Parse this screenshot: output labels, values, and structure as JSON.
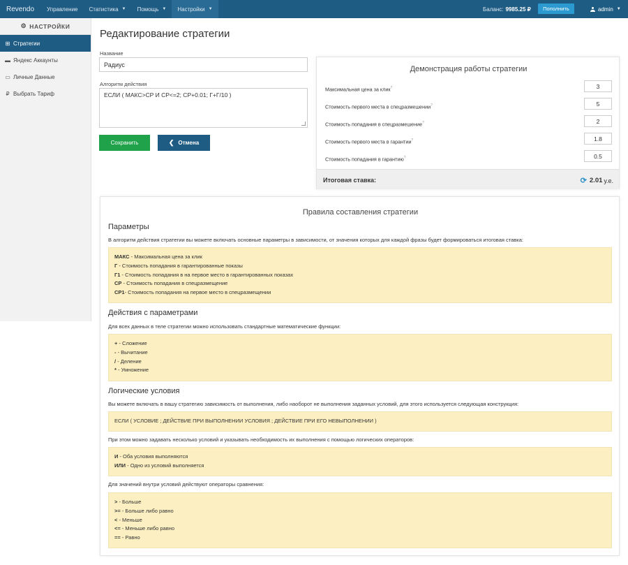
{
  "topbar": {
    "brand": "Revendo",
    "nav": [
      {
        "label": "Управление",
        "dropdown": false
      },
      {
        "label": "Статистика",
        "dropdown": true
      },
      {
        "label": "Помощь",
        "dropdown": true
      },
      {
        "label": "Настройки",
        "dropdown": true,
        "active": true
      }
    ],
    "balance_label": "Баланс:",
    "balance_value": "9985.25 ₽",
    "topup_button": "Пополнить",
    "user": "admin"
  },
  "sidebar": {
    "heading": "НАСТРОЙКИ",
    "items": [
      {
        "label": "Стратегии",
        "icon": "sitemap-icon",
        "active": true
      },
      {
        "label": "Яндекс Аккаунты",
        "icon": "car-icon",
        "active": false
      },
      {
        "label": "Личные Данные",
        "icon": "id-card-icon",
        "active": false
      },
      {
        "label": "Выбрать Тариф",
        "icon": "ruble-icon",
        "active": false
      }
    ]
  },
  "main": {
    "title": "Редактирование стратегии",
    "name_label": "Название",
    "name_value": "Радиус",
    "algo_label": "Алгоритм действия",
    "algo_value": "ЕСЛИ ( МАКС>СР И СР<=2; СР+0.01; Г+Г/10 )",
    "save_button": "Сохранить",
    "cancel_button": "Отмена"
  },
  "demo": {
    "title": "Демонстрация работы стратегии",
    "rows": [
      {
        "label": "Максимальная цена за клик",
        "value": "3"
      },
      {
        "label": "Стоимость первого места в спецразмешении",
        "value": "5"
      },
      {
        "label": "Стоимость попадания в спецразмешение",
        "value": "2"
      },
      {
        "label": "Стоимость первого места в гарантии",
        "value": "1.8"
      },
      {
        "label": "Стоимость попадания в гарантию",
        "value": "0.5"
      }
    ],
    "total_label": "Итоговая ставка:",
    "total_value": "2.01",
    "total_unit": "у.е."
  },
  "rules": {
    "title": "Правила составления стратегии",
    "params_heading": "Параметры",
    "params_intro": "В алгоритм действия стратегии вы можете включать основные параметры в зависимости, от значения которых для каждой фразы будет формироваться итоговая ставка:",
    "params": [
      {
        "key": "МАКС",
        "desc": " - Максимальная цена за клик"
      },
      {
        "key": "Г",
        "desc": " - Стоимость попадания в гарантированные показы"
      },
      {
        "key": "Г1",
        "desc": " - Стоимость попадания в на первое место в гарантированных показах"
      },
      {
        "key": "СР",
        "desc": " - Стоимость попадания в спецразмещение"
      },
      {
        "key": "СР1",
        "desc": "- Стоимость попадания на первое место в спецразмещении"
      }
    ],
    "actions_heading": "Действия с параметрами",
    "actions_intro": "Для всех данных в теле стратегии можно использовать стандартные математические функции:",
    "actions": [
      {
        "key": "+",
        "desc": " - Сложение"
      },
      {
        "key": "-",
        "desc": " - Вычитание"
      },
      {
        "key": "/",
        "desc": " - Деление"
      },
      {
        "key": "*",
        "desc": " - Умножение"
      }
    ],
    "logic_heading": "Логические условия",
    "logic_intro": "Вы можете включать в вашу стратегию зависимость от выполнения, либо наоборот не выполнения заданных условий, для этого используется следующая конструкция:",
    "logic_construct": "ЕСЛИ ( УСЛОВИЕ ; ДЕЙСТВИЕ ПРИ ВЫПОЛНЕНИИ УСЛОВИЯ ; ДЕЙСТВИЕ ПРИ ЕГО НЕВЫПОЛНЕНИИ )",
    "logic_ops_intro": "При этом можно задавать несколько условий и указывать необходимость их выполнения с помощью логических операторов:",
    "logic_ops": [
      {
        "key": "И",
        "desc": " - Оба условия выполняются"
      },
      {
        "key": "ИЛИ",
        "desc": " - Одно из условий выполняется"
      }
    ],
    "compare_intro": "Для значений внутри условий действуют операторы сравнения:",
    "compare_ops": [
      {
        "key": ">",
        "desc": " - Больше"
      },
      {
        "key": ">=",
        "desc": " - Больше либо равно"
      },
      {
        "key": "<",
        "desc": " - Меньше"
      },
      {
        "key": "<=",
        "desc": " - Меньше либо равно"
      },
      {
        "key": "==",
        "desc": " - Равно"
      }
    ]
  },
  "colors": {
    "nav_bg": "#1f5c84",
    "save_green": "#1fa24a",
    "topup_blue": "#2b9ad1",
    "note_yellow": "#fcefc1"
  }
}
